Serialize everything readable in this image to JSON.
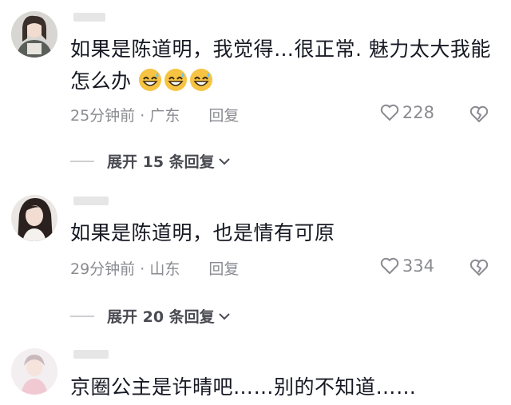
{
  "comments": [
    {
      "text_line1": "如果是陈道明，我觉得…很正常. 魅力太大我能",
      "text_line2": "怎么办",
      "time": "25分钟前",
      "location": "广东",
      "reply_label": "回复",
      "likes": "228",
      "expand_label": "展开 15 条回复"
    },
    {
      "text_line1": "如果是陈道明，也是情有可原",
      "time": "29分钟前",
      "location": "山东",
      "reply_label": "回复",
      "likes": "334",
      "expand_label": "展开 20 条回复"
    },
    {
      "text_line1": "京圈公主是许晴吧……别的不知道……"
    }
  ],
  "separator": "·",
  "icons": {
    "like": "heart-icon",
    "dislike": "broken-heart-icon",
    "expand": "chevron-down-icon",
    "emoji": "grinning-sweat-emoji"
  },
  "colors": {
    "text": "#161823",
    "meta": "#8a8b91",
    "emoji": "#f6c343"
  }
}
